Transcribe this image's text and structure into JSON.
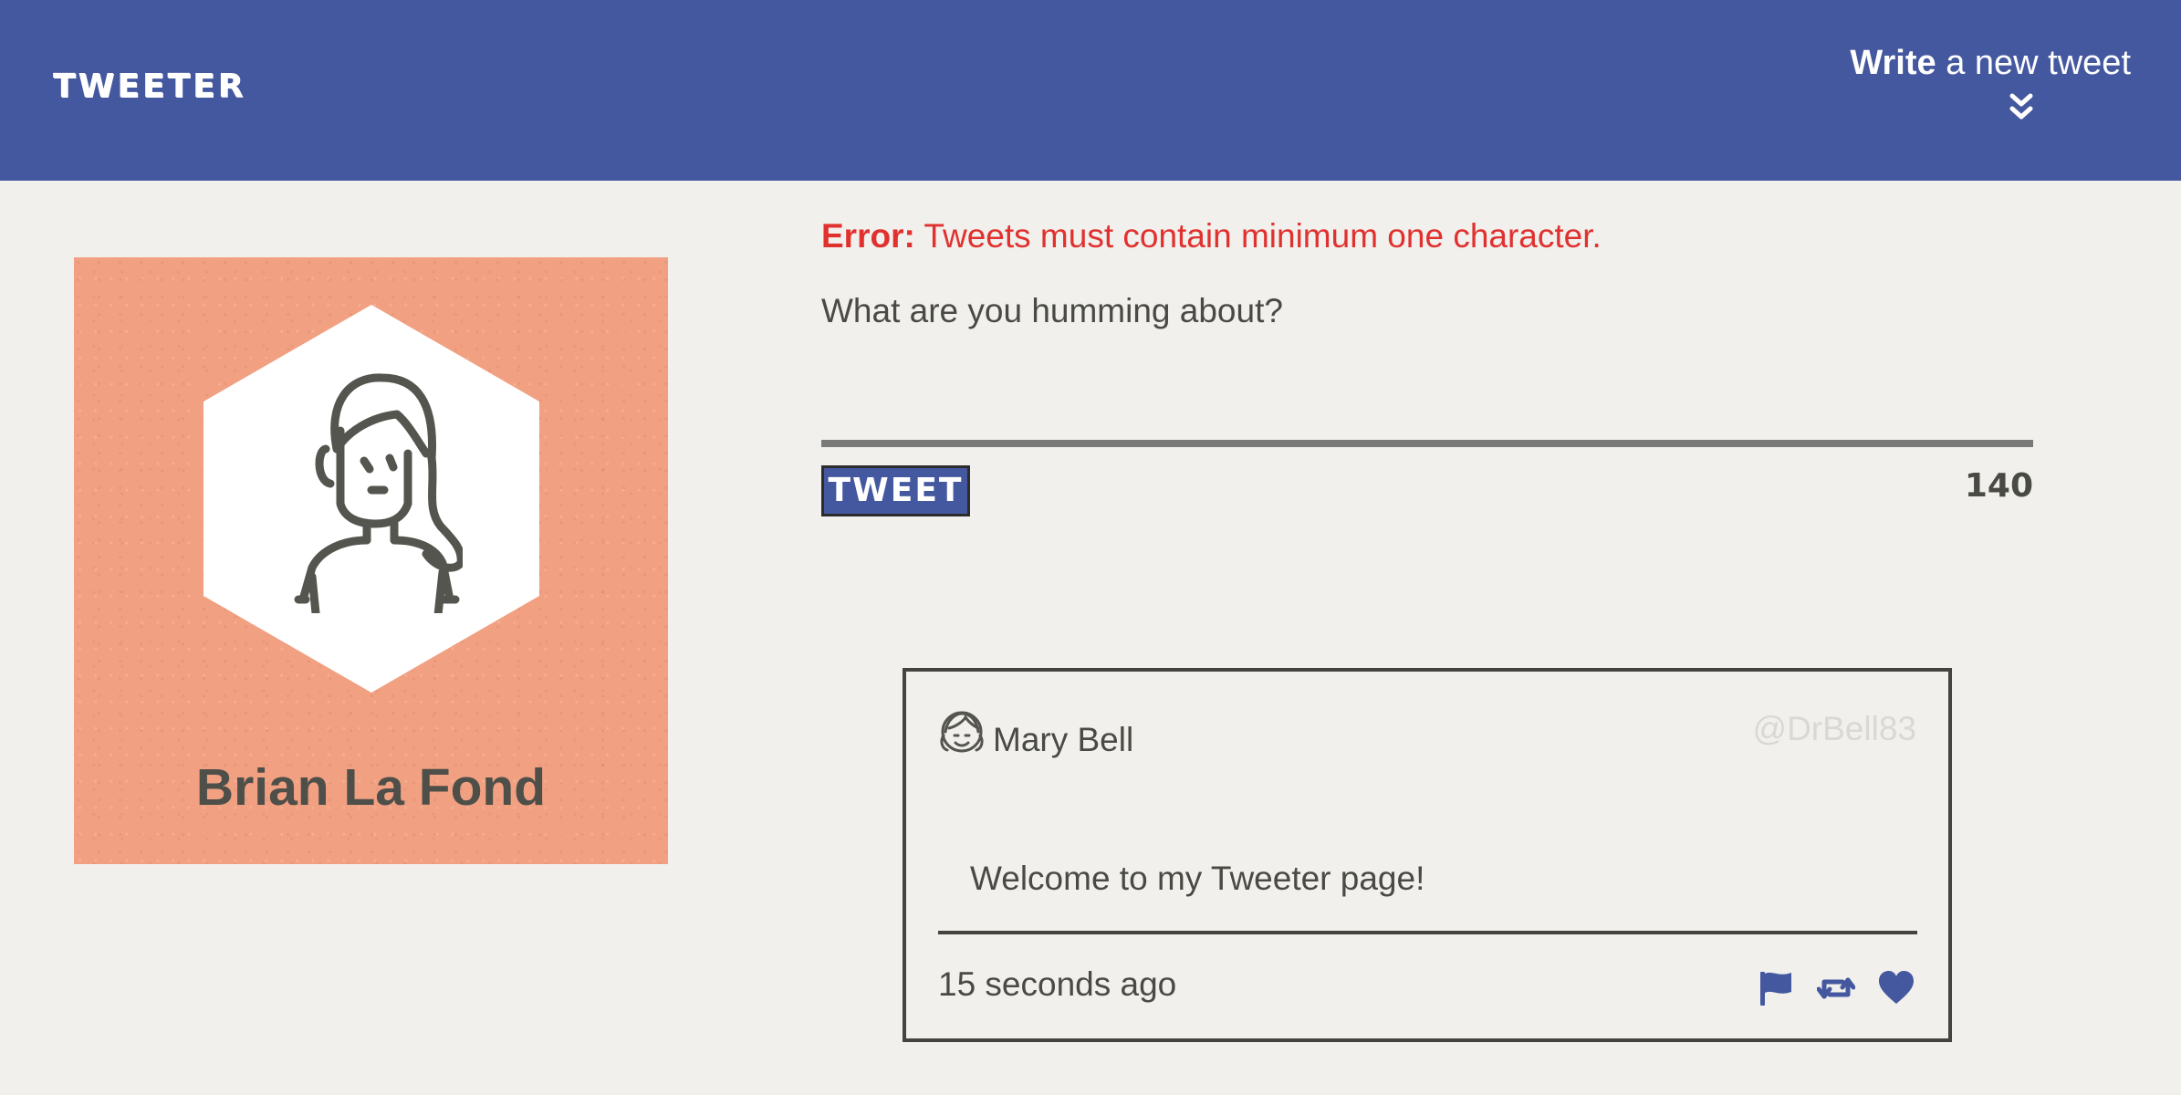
{
  "nav": {
    "brand": "TWEETER",
    "compose_bold": "Write",
    "compose_rest": " a new tweet"
  },
  "profile": {
    "name": "Brian La Fond"
  },
  "composer": {
    "error_label": "Error:",
    "error_message": " Tweets must contain minimum one character.",
    "prompt": "What are you humming about?",
    "input_value": "",
    "button_label": "TWEET",
    "char_count": "140"
  },
  "tweet": {
    "author_name": "Mary Bell",
    "author_handle": "@DrBell83",
    "content": "Welcome to my Tweeter page!",
    "timestamp": "15 seconds ago",
    "actions": [
      "flag-icon",
      "retweet-icon",
      "heart-icon"
    ]
  },
  "colors": {
    "nav_bg": "#44589f",
    "page_bg": "#f1f0ec",
    "profile_bg": "#f2a082",
    "error": "#e0312f",
    "accent": "#44589f"
  }
}
